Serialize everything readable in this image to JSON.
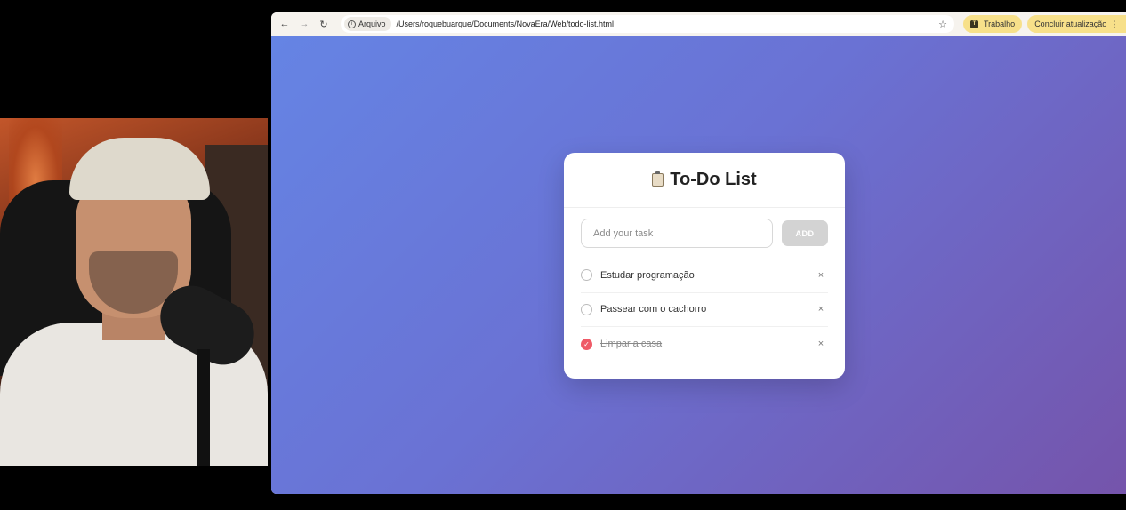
{
  "browser": {
    "url_chip_label": "Arquivo",
    "url": "/Users/roquebuarque/Documents/NovaEra/Web/todo-list.html",
    "profile_label": "Trabalho",
    "update_label": "Concluir atualização"
  },
  "app": {
    "title": "To-Do List",
    "input_placeholder": "Add your task",
    "add_label": "ADD",
    "tasks": [
      {
        "text": "Estudar programação",
        "done": false
      },
      {
        "text": "Passear com o cachorro",
        "done": false
      },
      {
        "text": "Limpar a casa",
        "done": true
      }
    ],
    "accent_color": "#ef5a67"
  }
}
